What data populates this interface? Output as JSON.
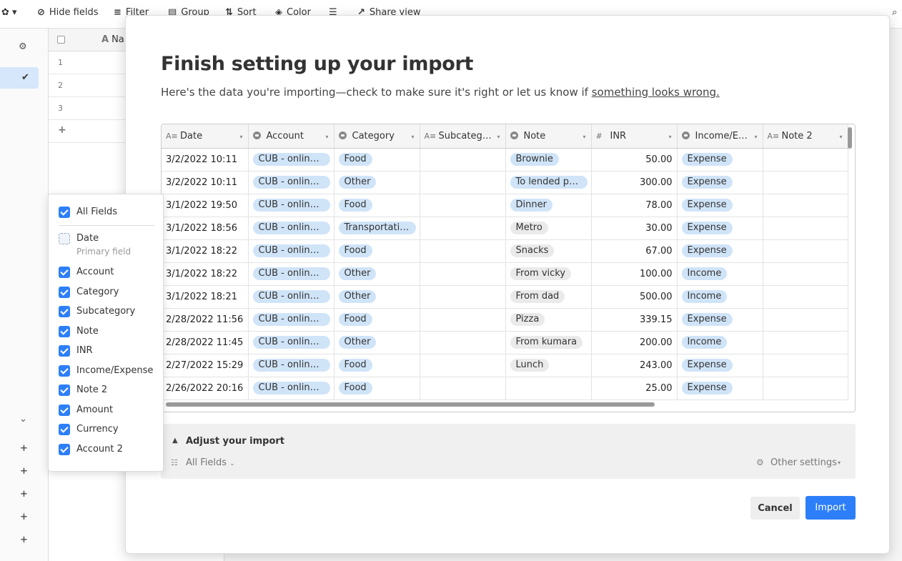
{
  "toolbar": {
    "hide_fields": "Hide fields",
    "filter": "Filter",
    "group": "Group",
    "sort": "Sort",
    "color": "Color",
    "share_view": "Share view"
  },
  "grid": {
    "field_name": "Na",
    "rows": [
      "1",
      "2",
      "3"
    ],
    "add": "+"
  },
  "modal": {
    "title": "Finish setting up your import",
    "subtitle_prefix": "Here's the data you're importing—check to make sure it's right or let us know if ",
    "subtitle_link": "something looks wrong."
  },
  "table": {
    "columns": [
      {
        "label": "Date",
        "icon": "text-field-icon"
      },
      {
        "label": "Account",
        "icon": "single-select-icon"
      },
      {
        "label": "Category",
        "icon": "single-select-icon"
      },
      {
        "label": "Subcateg…",
        "icon": "text-field-icon"
      },
      {
        "label": "Note",
        "icon": "single-select-icon"
      },
      {
        "label": "INR",
        "icon": "number-field-icon"
      },
      {
        "label": "Income/E…",
        "icon": "single-select-icon"
      },
      {
        "label": "Note 2",
        "icon": "text-field-icon"
      }
    ],
    "rows": [
      {
        "date": "3/2/2022 10:11",
        "account": "CUB - online …",
        "category": "Food",
        "subcategory": "",
        "note": "Brownie",
        "inr": "50.00",
        "type": "Expense",
        "note2": ""
      },
      {
        "date": "3/2/2022 10:11",
        "account": "CUB - online …",
        "category": "Other",
        "subcategory": "",
        "note": "To lended pe…",
        "inr": "300.00",
        "type": "Expense",
        "note2": ""
      },
      {
        "date": "3/1/2022 19:50",
        "account": "CUB - online …",
        "category": "Food",
        "subcategory": "",
        "note": "Dinner",
        "inr": "78.00",
        "type": "Expense",
        "note2": ""
      },
      {
        "date": "3/1/2022 18:56",
        "account": "CUB - online …",
        "category": "Transportation",
        "subcategory": "",
        "note": "Metro",
        "inr": "30.00",
        "type": "Expense",
        "note2": ""
      },
      {
        "date": "3/1/2022 18:22",
        "account": "CUB - online …",
        "category": "Food",
        "subcategory": "",
        "note": "Snacks",
        "inr": "67.00",
        "type": "Expense",
        "note2": ""
      },
      {
        "date": "3/1/2022 18:22",
        "account": "CUB - online …",
        "category": "Other",
        "subcategory": "",
        "note": "From vicky",
        "inr": "100.00",
        "type": "Income",
        "note2": ""
      },
      {
        "date": "3/1/2022 18:21",
        "account": "CUB - online …",
        "category": "Other",
        "subcategory": "",
        "note": "From dad",
        "inr": "500.00",
        "type": "Income",
        "note2": ""
      },
      {
        "date": "2/28/2022 11:56",
        "account": "CUB - online …",
        "category": "Food",
        "subcategory": "",
        "note": "Pizza",
        "inr": "339.15",
        "type": "Expense",
        "note2": ""
      },
      {
        "date": "2/28/2022 11:45",
        "account": "CUB - online …",
        "category": "Other",
        "subcategory": "",
        "note": "From kumara",
        "inr": "200.00",
        "type": "Income",
        "note2": ""
      },
      {
        "date": "2/27/2022 15:29",
        "account": "CUB - online …",
        "category": "Food",
        "subcategory": "",
        "note": "Lunch",
        "inr": "243.00",
        "type": "Expense",
        "note2": ""
      },
      {
        "date": "2/26/2022 20:16",
        "account": "CUB - online …",
        "category": "Food",
        "subcategory": "",
        "note": "",
        "inr": "25.00",
        "type": "Expense",
        "note2": ""
      }
    ]
  },
  "adjust": {
    "title": "Adjust your import",
    "fields_selector": "All Fields",
    "other_settings": "Other settings"
  },
  "buttons": {
    "cancel": "Cancel",
    "import": "Import"
  },
  "fields_popover": {
    "all_fields": "All Fields",
    "primary": {
      "label": "Date",
      "sub": "Primary field"
    },
    "fields": [
      "Account",
      "Category",
      "Subcategory",
      "Note",
      "INR",
      "Income/Expense",
      "Note 2",
      "Amount",
      "Currency",
      "Account 2"
    ]
  },
  "colors": {
    "accent": "#2d7ff9",
    "pill_blue": "#d0e4f8",
    "pill_gray": "#eaeaea"
  }
}
